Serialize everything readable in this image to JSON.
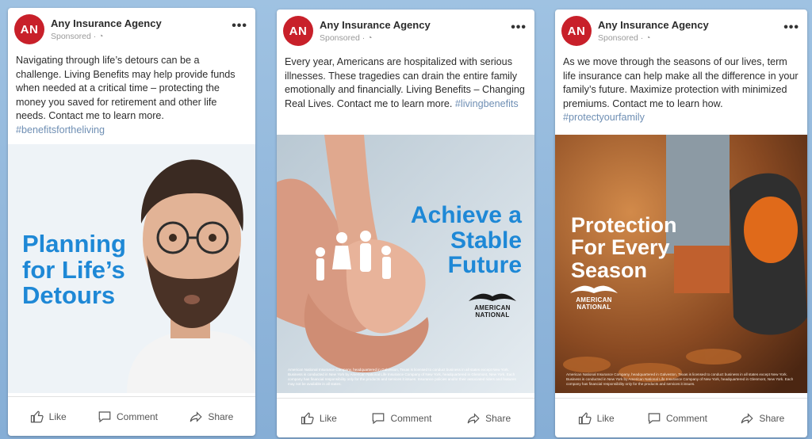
{
  "colors": {
    "avatar_bg": "#c8202a",
    "headline_blue": "#1e88d6",
    "hashtag": "#6f8fb4"
  },
  "cards": [
    {
      "avatar": "AN",
      "agency": "Any Insurance Agency",
      "sponsored": "Sponsored · ",
      "caption": "Navigating through life’s detours can be a challenge. Living Benefits may help provide funds when needed at a critical time – protecting the money you saved for retirement and other life needs. Contact me to learn more.",
      "hashtag": "#benefitsfortheliving",
      "headline": "Planning for Life’s Detours",
      "brand": "",
      "disclaimer": "",
      "actions": {
        "like": "Like",
        "comment": "Comment",
        "share": "Share"
      }
    },
    {
      "avatar": "AN",
      "agency": "Any Insurance Agency",
      "sponsored": "Sponsored · ",
      "caption": "Every year, Americans are hospitalized with serious illnesses. These tragedies can drain the entire family emotionally and financially. Living Benefits – Changing Real Lives. Contact me to learn more.",
      "hashtag": "#livingbenefits",
      "headline": "Achieve a Stable Future",
      "brand": "AMERICAN NATIONAL",
      "disclaimer": "American National Insurance Company, headquartered in Galveston, Texas is licensed to conduct business in all states except New York. Business is conducted in New York by American National Life Insurance Company of New York, headquartered in Glenmont, New York. Each company has financial responsibility only for the products and services it issues. Insurance policies and/or their associated riders and features may not be available in all states.",
      "actions": {
        "like": "Like",
        "comment": "Comment",
        "share": "Share"
      }
    },
    {
      "avatar": "AN",
      "agency": "Any Insurance Agency",
      "sponsored": "Sponsored · ",
      "caption": "As we move through the seasons of our lives, term life insurance can help make all the difference in your family’s future. Maximize protection with minimized premiums. Contact me to learn how.",
      "hashtag": "#protectyourfamily",
      "headline": "Protection For Every Season",
      "brand": "AMERICAN NATIONAL",
      "disclaimer": "American National Insurance Company, headquartered in Galveston, Texas is licensed to conduct business in all states except New York. Business is conducted in New York by American National Life Insurance Company of New York, headquartered in Glenmont, New York. Each company has financial responsibility only for the products and services it issues.",
      "actions": {
        "like": "Like",
        "comment": "Comment",
        "share": "Share"
      }
    }
  ]
}
